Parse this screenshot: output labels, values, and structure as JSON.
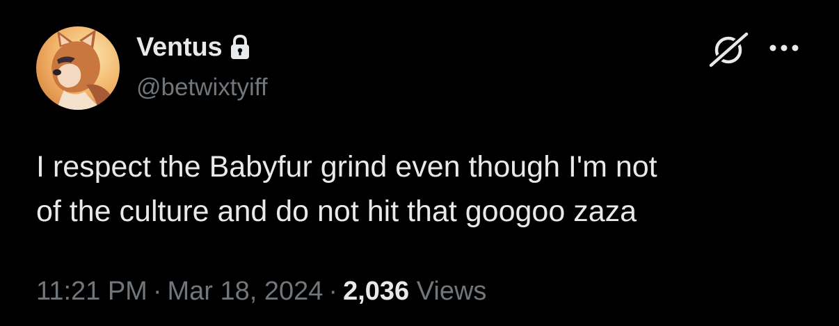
{
  "author": {
    "display_name": "Ventus",
    "handle": "@betwixtyiff",
    "protected_icon": "lock-icon",
    "avatar_icon": "fox-avatar"
  },
  "header_actions": {
    "grok_icon": "grok-icon",
    "more_icon": "more-options-icon"
  },
  "tweet": {
    "line1": "I respect the Babyfur grind even though I'm not",
    "line2": "of the culture and do not hit that googoo zaza"
  },
  "meta": {
    "time": "11:21 PM",
    "separator": "·",
    "date": "Mar 18, 2024",
    "views_count": "2,036",
    "views_label": "Views"
  },
  "colors": {
    "background": "#000000",
    "primary_text": "#e7e9ea",
    "secondary_text": "#71767b"
  }
}
